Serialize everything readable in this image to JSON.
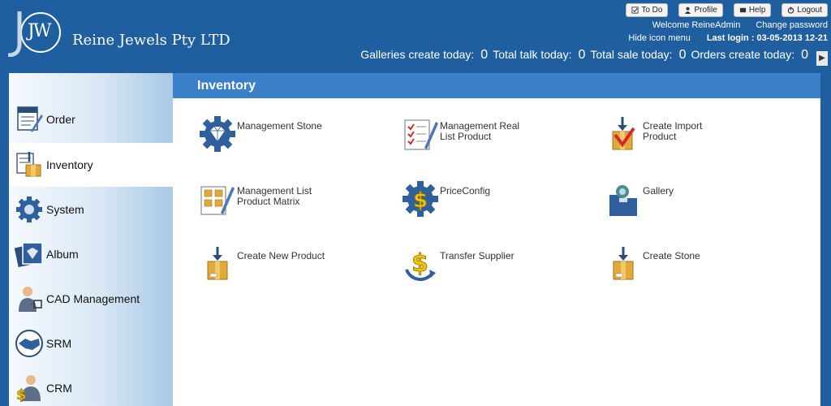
{
  "header": {
    "company_name": "Reine Jewels Pty LTD",
    "logo_initials": "JW",
    "buttons": {
      "todo": "To Do",
      "profile": "Profile",
      "help": "Help",
      "logout": "Logout"
    },
    "welcome": "Welcome ReineAdmin",
    "change_password": "Change password",
    "hide_icon_menu": "Hide icon menu",
    "last_login": "Last login : 03-05-2013 12-21",
    "stats": [
      {
        "label": "Galleries create today:",
        "value": "0"
      },
      {
        "label": "Total talk today:",
        "value": "0"
      },
      {
        "label": "Total sale today:",
        "value": "0"
      },
      {
        "label": "Orders create today:",
        "value": "0"
      }
    ]
  },
  "sidebar": {
    "items": [
      {
        "label": "Order",
        "icon": "order-icon"
      },
      {
        "label": "Inventory",
        "icon": "inventory-icon",
        "active": true
      },
      {
        "label": "System",
        "icon": "system-gear-icon"
      },
      {
        "label": "Album",
        "icon": "album-icon"
      },
      {
        "label": "CAD Management",
        "icon": "cad-icon"
      },
      {
        "label": "SRM",
        "icon": "handshake-icon"
      },
      {
        "label": "CRM",
        "icon": "crm-icon"
      }
    ]
  },
  "main": {
    "title": "Inventory",
    "tiles": [
      {
        "line1": "Management Stone",
        "line2": "",
        "icon": "diamond-gear-icon"
      },
      {
        "line1": "Management Real",
        "line2": "List Product",
        "icon": "checklist-icon"
      },
      {
        "line1": "Create Import",
        "line2": "Product",
        "icon": "import-box-icon"
      },
      {
        "line1": "Management List",
        "line2": "Product Matrix",
        "icon": "matrix-icon"
      },
      {
        "line1": "PriceConfig",
        "line2": "",
        "icon": "dollar-gear-icon"
      },
      {
        "line1": "Gallery",
        "line2": "",
        "icon": "gallery-folder-icon"
      },
      {
        "line1": "Create New Product",
        "line2": "",
        "icon": "new-box-icon"
      },
      {
        "line1": "Transfer Supplier",
        "line2": "",
        "icon": "dollar-transfer-icon"
      },
      {
        "line1": "Create Stone",
        "line2": "",
        "icon": "stone-box-icon"
      }
    ]
  },
  "colors": {
    "header_bg": "#1f5fa0",
    "title_bar": "#3a80c9"
  }
}
